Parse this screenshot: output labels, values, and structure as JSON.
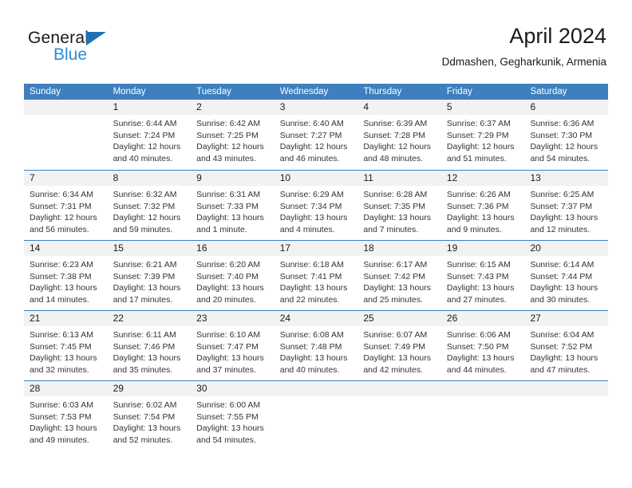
{
  "brand": {
    "line1": "General",
    "line2": "Blue",
    "flag_color": "#1f6fb4",
    "blue_color": "#2e8bd4"
  },
  "header": {
    "title": "April 2024",
    "subtitle": "Ddmashen, Gegharkunik, Armenia"
  },
  "theme": {
    "header_blue": "#3d7fbf",
    "day_number_bg": "#f2f2f2",
    "text": "#222222"
  },
  "weekdays": [
    "Sunday",
    "Monday",
    "Tuesday",
    "Wednesday",
    "Thursday",
    "Friday",
    "Saturday"
  ],
  "weeks": [
    {
      "days": [
        {
          "number": "",
          "lines": [
            "",
            "",
            "",
            ""
          ]
        },
        {
          "number": "1",
          "lines": [
            "Sunrise: 6:44 AM",
            "Sunset: 7:24 PM",
            "Daylight: 12 hours",
            "and 40 minutes."
          ]
        },
        {
          "number": "2",
          "lines": [
            "Sunrise: 6:42 AM",
            "Sunset: 7:25 PM",
            "Daylight: 12 hours",
            "and 43 minutes."
          ]
        },
        {
          "number": "3",
          "lines": [
            "Sunrise: 6:40 AM",
            "Sunset: 7:27 PM",
            "Daylight: 12 hours",
            "and 46 minutes."
          ]
        },
        {
          "number": "4",
          "lines": [
            "Sunrise: 6:39 AM",
            "Sunset: 7:28 PM",
            "Daylight: 12 hours",
            "and 48 minutes."
          ]
        },
        {
          "number": "5",
          "lines": [
            "Sunrise: 6:37 AM",
            "Sunset: 7:29 PM",
            "Daylight: 12 hours",
            "and 51 minutes."
          ]
        },
        {
          "number": "6",
          "lines": [
            "Sunrise: 6:36 AM",
            "Sunset: 7:30 PM",
            "Daylight: 12 hours",
            "and 54 minutes."
          ]
        }
      ]
    },
    {
      "days": [
        {
          "number": "7",
          "lines": [
            "Sunrise: 6:34 AM",
            "Sunset: 7:31 PM",
            "Daylight: 12 hours",
            "and 56 minutes."
          ]
        },
        {
          "number": "8",
          "lines": [
            "Sunrise: 6:32 AM",
            "Sunset: 7:32 PM",
            "Daylight: 12 hours",
            "and 59 minutes."
          ]
        },
        {
          "number": "9",
          "lines": [
            "Sunrise: 6:31 AM",
            "Sunset: 7:33 PM",
            "Daylight: 13 hours",
            "and 1 minute."
          ]
        },
        {
          "number": "10",
          "lines": [
            "Sunrise: 6:29 AM",
            "Sunset: 7:34 PM",
            "Daylight: 13 hours",
            "and 4 minutes."
          ]
        },
        {
          "number": "11",
          "lines": [
            "Sunrise: 6:28 AM",
            "Sunset: 7:35 PM",
            "Daylight: 13 hours",
            "and 7 minutes."
          ]
        },
        {
          "number": "12",
          "lines": [
            "Sunrise: 6:26 AM",
            "Sunset: 7:36 PM",
            "Daylight: 13 hours",
            "and 9 minutes."
          ]
        },
        {
          "number": "13",
          "lines": [
            "Sunrise: 6:25 AM",
            "Sunset: 7:37 PM",
            "Daylight: 13 hours",
            "and 12 minutes."
          ]
        }
      ]
    },
    {
      "days": [
        {
          "number": "14",
          "lines": [
            "Sunrise: 6:23 AM",
            "Sunset: 7:38 PM",
            "Daylight: 13 hours",
            "and 14 minutes."
          ]
        },
        {
          "number": "15",
          "lines": [
            "Sunrise: 6:21 AM",
            "Sunset: 7:39 PM",
            "Daylight: 13 hours",
            "and 17 minutes."
          ]
        },
        {
          "number": "16",
          "lines": [
            "Sunrise: 6:20 AM",
            "Sunset: 7:40 PM",
            "Daylight: 13 hours",
            "and 20 minutes."
          ]
        },
        {
          "number": "17",
          "lines": [
            "Sunrise: 6:18 AM",
            "Sunset: 7:41 PM",
            "Daylight: 13 hours",
            "and 22 minutes."
          ]
        },
        {
          "number": "18",
          "lines": [
            "Sunrise: 6:17 AM",
            "Sunset: 7:42 PM",
            "Daylight: 13 hours",
            "and 25 minutes."
          ]
        },
        {
          "number": "19",
          "lines": [
            "Sunrise: 6:15 AM",
            "Sunset: 7:43 PM",
            "Daylight: 13 hours",
            "and 27 minutes."
          ]
        },
        {
          "number": "20",
          "lines": [
            "Sunrise: 6:14 AM",
            "Sunset: 7:44 PM",
            "Daylight: 13 hours",
            "and 30 minutes."
          ]
        }
      ]
    },
    {
      "days": [
        {
          "number": "21",
          "lines": [
            "Sunrise: 6:13 AM",
            "Sunset: 7:45 PM",
            "Daylight: 13 hours",
            "and 32 minutes."
          ]
        },
        {
          "number": "22",
          "lines": [
            "Sunrise: 6:11 AM",
            "Sunset: 7:46 PM",
            "Daylight: 13 hours",
            "and 35 minutes."
          ]
        },
        {
          "number": "23",
          "lines": [
            "Sunrise: 6:10 AM",
            "Sunset: 7:47 PM",
            "Daylight: 13 hours",
            "and 37 minutes."
          ]
        },
        {
          "number": "24",
          "lines": [
            "Sunrise: 6:08 AM",
            "Sunset: 7:48 PM",
            "Daylight: 13 hours",
            "and 40 minutes."
          ]
        },
        {
          "number": "25",
          "lines": [
            "Sunrise: 6:07 AM",
            "Sunset: 7:49 PM",
            "Daylight: 13 hours",
            "and 42 minutes."
          ]
        },
        {
          "number": "26",
          "lines": [
            "Sunrise: 6:06 AM",
            "Sunset: 7:50 PM",
            "Daylight: 13 hours",
            "and 44 minutes."
          ]
        },
        {
          "number": "27",
          "lines": [
            "Sunrise: 6:04 AM",
            "Sunset: 7:52 PM",
            "Daylight: 13 hours",
            "and 47 minutes."
          ]
        }
      ]
    },
    {
      "days": [
        {
          "number": "28",
          "lines": [
            "Sunrise: 6:03 AM",
            "Sunset: 7:53 PM",
            "Daylight: 13 hours",
            "and 49 minutes."
          ]
        },
        {
          "number": "29",
          "lines": [
            "Sunrise: 6:02 AM",
            "Sunset: 7:54 PM",
            "Daylight: 13 hours",
            "and 52 minutes."
          ]
        },
        {
          "number": "30",
          "lines": [
            "Sunrise: 6:00 AM",
            "Sunset: 7:55 PM",
            "Daylight: 13 hours",
            "and 54 minutes."
          ]
        },
        {
          "number": "",
          "lines": [
            "",
            "",
            "",
            ""
          ]
        },
        {
          "number": "",
          "lines": [
            "",
            "",
            "",
            ""
          ]
        },
        {
          "number": "",
          "lines": [
            "",
            "",
            "",
            ""
          ]
        },
        {
          "number": "",
          "lines": [
            "",
            "",
            "",
            ""
          ]
        }
      ]
    }
  ]
}
